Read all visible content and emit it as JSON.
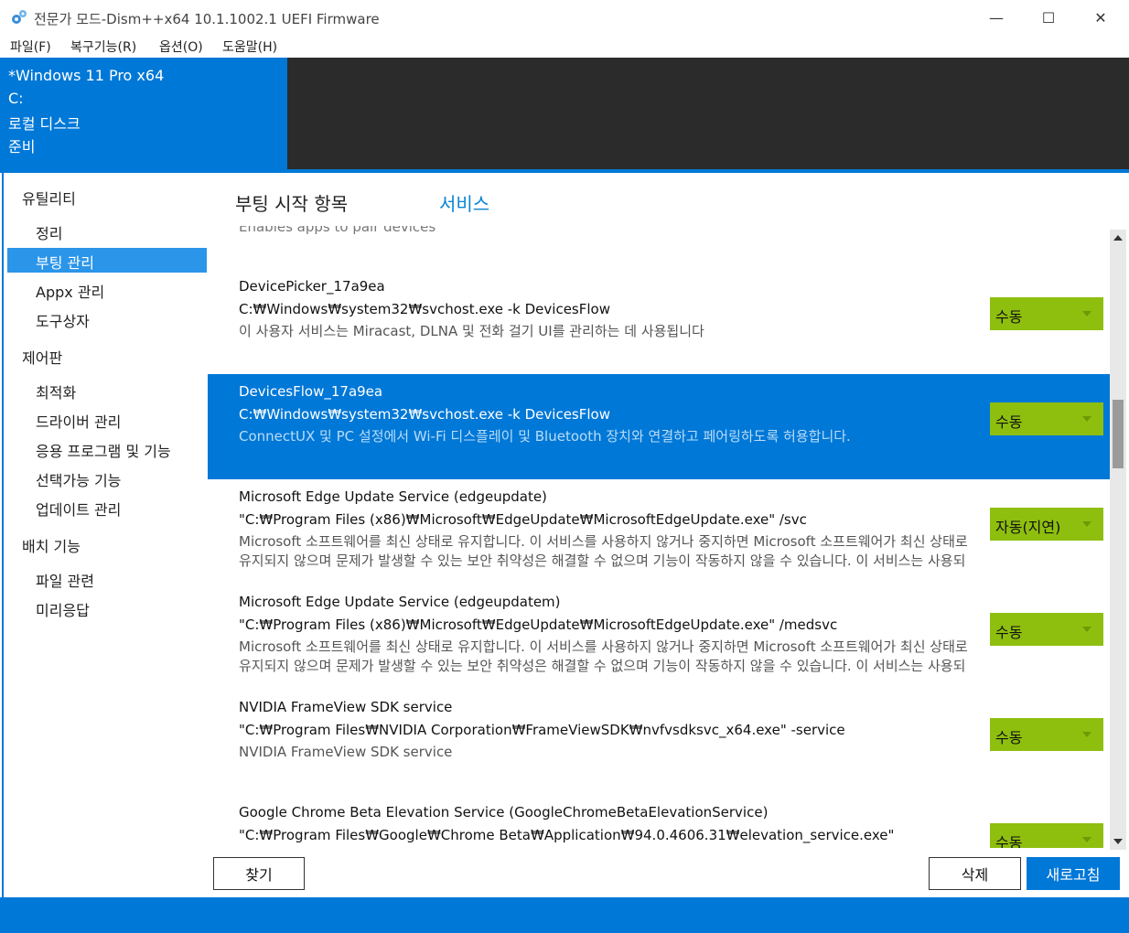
{
  "window": {
    "title": "전문가 모드-Dism++x64 10.1.1002.1 UEFI Firmware",
    "minimize_icon": "—",
    "maximize_icon": "☐",
    "close_icon": "✕"
  },
  "menu": [
    "파일(F)",
    "복구기능(R)",
    "옵션(O)",
    "도움말(H)"
  ],
  "header": {
    "lines": [
      "*Windows 11 Pro x64",
      "C:",
      "로컬 디스크",
      "준비"
    ],
    "accent_color": "#0078d7"
  },
  "nav": {
    "categories": [
      {
        "label": "유틸리티",
        "items": [
          {
            "label": "정리",
            "active": false
          },
          {
            "label": "부팅 관리",
            "active": true
          },
          {
            "label": "Appx 관리",
            "active": false
          },
          {
            "label": "도구상자",
            "active": false
          }
        ]
      },
      {
        "label": "제어판",
        "items": [
          {
            "label": "최적화",
            "active": false
          },
          {
            "label": "드라이버 관리",
            "active": false
          },
          {
            "label": "응용 프로그램 및 기능",
            "active": false
          },
          {
            "label": "선택가능 기능",
            "active": false
          },
          {
            "label": "업데이트 관리",
            "active": false
          }
        ]
      },
      {
        "label": "배치 기능",
        "items": [
          {
            "label": "파일 관련",
            "active": false
          },
          {
            "label": "미리응답",
            "active": false
          }
        ]
      }
    ]
  },
  "tabs": [
    {
      "label": "부팅 시작 항목",
      "active": false
    },
    {
      "label": "서비스",
      "active": true
    }
  ],
  "partial_top_text": "Enables apps to pair devices",
  "services": [
    {
      "name": "DevicePicker_17a9ea",
      "path": "C:₩Windows₩system32₩svchost.exe -k DevicesFlow",
      "description": "이 사용자 서비스는 Miracast, DLNA 및 전화 걸기 UI를 관리하는 데 사용됩니다",
      "startup": "수동",
      "selected": false
    },
    {
      "name": "DevicesFlow_17a9ea",
      "path": "C:₩Windows₩system32₩svchost.exe -k DevicesFlow",
      "description": "ConnectUX 및 PC 설정에서 Wi-Fi 디스플레이 및 Bluetooth 장치와 연결하고 페어링하도록 허용합니다.",
      "startup": "수동",
      "selected": true
    },
    {
      "name": "Microsoft Edge Update Service (edgeupdate)",
      "path": "\"C:₩Program Files (x86)₩Microsoft₩EdgeUpdate₩MicrosoftEdgeUpdate.exe\" /svc",
      "description": "Microsoft 소프트웨어를 최신 상태로 유지합니다. 이 서비스를 사용하지 않거나 중지하면 Microsoft 소프트웨어가 최신 상태로 유지되지 않으며 문제가 발생할 수 있는 보안 취약성은 해결할 수 없으며 기능이 작동하지 않을 수 있습니다. 이 서비스는 사용되고 있는 Microsoft 소프트웨어가 없을 때 자체적으로 제거됩니다.",
      "startup": "자동(지연)",
      "selected": false
    },
    {
      "name": "Microsoft Edge Update Service (edgeupdatem)",
      "path": "\"C:₩Program Files (x86)₩Microsoft₩EdgeUpdate₩MicrosoftEdgeUpdate.exe\" /medsvc",
      "description": "Microsoft 소프트웨어를 최신 상태로 유지합니다. 이 서비스를 사용하지 않거나 중지하면 Microsoft 소프트웨어가 최신 상태로 유지되지 않으며 문제가 발생할 수 있는 보안 취약성은 해결할 수 없으며 기능이 작동하지 않을 수 있습니다. 이 서비스는 사용되고 있는 Microsoft 소프트웨어가 없을 때 자체적으로 제거됩니다.",
      "startup": "수동",
      "selected": false
    },
    {
      "name": "NVIDIA FrameView SDK service",
      "path": "\"C:₩Program Files₩NVIDIA Corporation₩FrameViewSDK₩nvfvsdksvc_x64.exe\" -service",
      "description": "NVIDIA FrameView SDK service",
      "startup": "수동",
      "selected": false
    },
    {
      "name": "Google Chrome Beta Elevation Service (GoogleChromeBetaElevationService)",
      "path": "\"C:₩Program Files₩Google₩Chrome Beta₩Application₩94.0.4606.31₩elevation_service.exe\"",
      "description": "",
      "startup": "수동",
      "selected": false
    }
  ],
  "buttons": {
    "find": "찾기",
    "delete": "삭제",
    "refresh": "새로고침"
  },
  "colors": {
    "accent": "#0078d7",
    "startup_select": "#8ebf0e",
    "selected_row": "#0078d7",
    "active_nav": "#2b95e9"
  }
}
